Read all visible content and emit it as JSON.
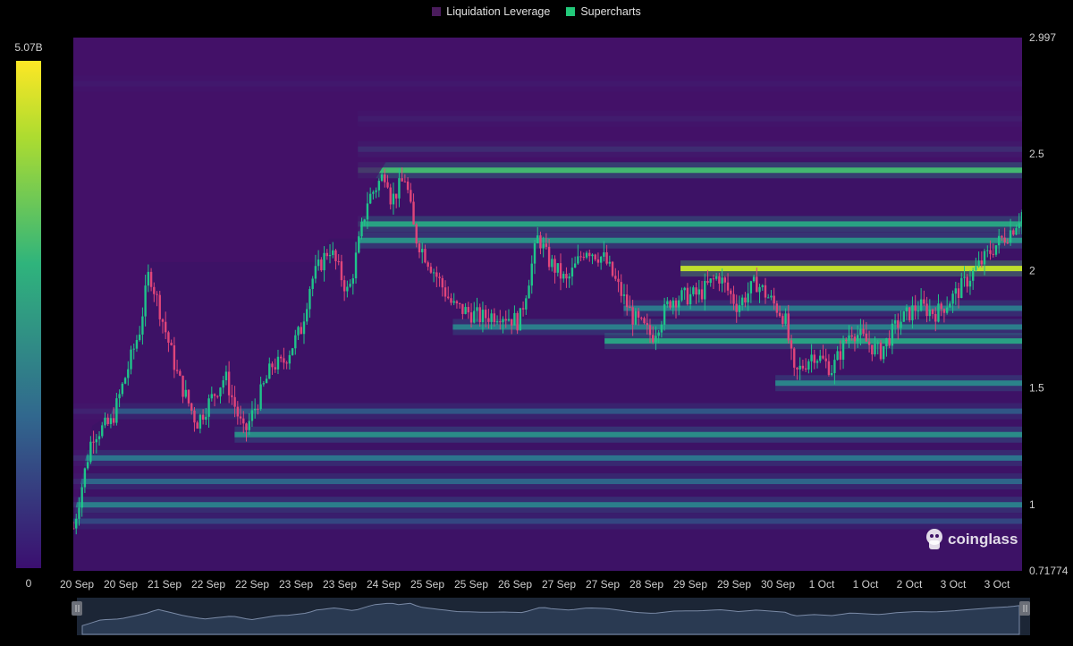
{
  "legend": {
    "items": [
      {
        "label": "Liquidation Leverage",
        "color": "#4a1c5c"
      },
      {
        "label": "Supercharts",
        "color": "#22c97a"
      }
    ]
  },
  "colorbar": {
    "max_label": "5.07B",
    "min_label": "0"
  },
  "watermark": {
    "text": "coinglass"
  },
  "chart_data": {
    "type": "heatmap",
    "title": "",
    "xlabel": "",
    "ylabel": "",
    "x_ticks": [
      "20 Sep",
      "20 Sep",
      "21 Sep",
      "22 Sep",
      "22 Sep",
      "23 Sep",
      "23 Sep",
      "24 Sep",
      "25 Sep",
      "25 Sep",
      "26 Sep",
      "27 Sep",
      "27 Sep",
      "28 Sep",
      "29 Sep",
      "29 Sep",
      "30 Sep",
      "1 Oct",
      "1 Oct",
      "2 Oct",
      "3 Oct",
      "3 Oct"
    ],
    "y_ticks": [
      "2.997",
      "2.5",
      "2",
      "1.5",
      "1",
      "0.71774"
    ],
    "y_tick_values": [
      2.997,
      2.5,
      2.0,
      1.5,
      1.0,
      0.71774
    ],
    "ylim": [
      0.71774,
      2.997
    ],
    "colorscale": [
      "#3b0f70",
      "#2c728e",
      "#28ae80",
      "#addc30",
      "#fde725"
    ],
    "colorbar_range": [
      0,
      5070000000
    ],
    "liquidation_levels": [
      {
        "price": 2.43,
        "start": 0.3,
        "intensity": 0.55
      },
      {
        "price": 2.52,
        "start": 0.3,
        "intensity": 0.3
      },
      {
        "price": 2.2,
        "start": 0.3,
        "intensity": 0.45
      },
      {
        "price": 2.13,
        "start": 0.3,
        "intensity": 0.38
      },
      {
        "price": 2.01,
        "start": 0.64,
        "intensity": 0.8
      },
      {
        "price": 1.84,
        "start": 0.58,
        "intensity": 0.28
      },
      {
        "price": 1.76,
        "start": 0.4,
        "intensity": 0.3
      },
      {
        "price": 1.7,
        "start": 0.56,
        "intensity": 0.45
      },
      {
        "price": 1.52,
        "start": 0.74,
        "intensity": 0.32
      },
      {
        "price": 1.4,
        "start": 0.0,
        "intensity": 0.18
      },
      {
        "price": 1.3,
        "start": 0.17,
        "intensity": 0.36
      },
      {
        "price": 1.2,
        "start": 0.0,
        "intensity": 0.26
      },
      {
        "price": 1.1,
        "start": 0.0,
        "intensity": 0.22
      },
      {
        "price": 1.0,
        "start": 0.0,
        "intensity": 0.3
      },
      {
        "price": 0.93,
        "start": 0.0,
        "intensity": 0.14
      },
      {
        "price": 2.65,
        "start": 0.3,
        "intensity": 0.12
      },
      {
        "price": 2.8,
        "start": 0.0,
        "intensity": 0.08
      }
    ],
    "price_path": {
      "t": [
        0.0,
        0.02,
        0.04,
        0.07,
        0.08,
        0.11,
        0.13,
        0.16,
        0.18,
        0.21,
        0.22,
        0.24,
        0.25,
        0.27,
        0.29,
        0.31,
        0.33,
        0.335,
        0.35,
        0.36,
        0.38,
        0.4,
        0.43,
        0.45,
        0.47,
        0.49,
        0.5,
        0.52,
        0.54,
        0.56,
        0.59,
        0.61,
        0.63,
        0.66,
        0.68,
        0.7,
        0.72,
        0.74,
        0.75,
        0.76,
        0.78,
        0.8,
        0.82,
        0.85,
        0.87,
        0.89,
        0.91,
        0.93,
        0.95,
        0.97,
        0.99,
        1.0
      ],
      "price": [
        0.9,
        1.3,
        1.35,
        1.75,
        2.0,
        1.55,
        1.35,
        1.55,
        1.3,
        1.6,
        1.6,
        1.75,
        1.95,
        2.1,
        1.9,
        2.3,
        2.43,
        2.3,
        2.4,
        2.15,
        2.0,
        1.85,
        1.8,
        1.82,
        1.78,
        2.15,
        2.05,
        1.95,
        2.1,
        2.05,
        1.8,
        1.72,
        1.88,
        1.9,
        1.98,
        1.85,
        1.95,
        1.85,
        1.8,
        1.55,
        1.65,
        1.58,
        1.75,
        1.65,
        1.78,
        1.85,
        1.82,
        1.9,
        2.0,
        2.1,
        2.18,
        2.25
      ]
    }
  }
}
